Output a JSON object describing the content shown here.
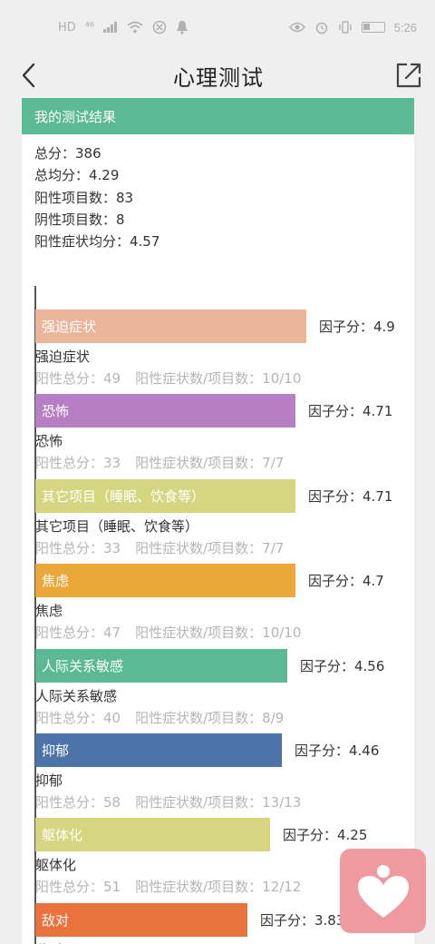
{
  "status": {
    "time": "5:26",
    "carrier": "HD",
    "net": "⁴⁶"
  },
  "nav": {
    "title": "心理测试"
  },
  "result": {
    "header": "我的测试结果",
    "lines": [
      "总分：386",
      "总均分：4.29",
      "阳性项目数：83",
      "阴性项目数：8",
      "阳性症状均分：4.57"
    ]
  },
  "chart_data": {
    "type": "bar",
    "orientation": "horizontal",
    "categories": [
      "强迫症状",
      "恐怖",
      "其它项目（睡眠、饮食等）",
      "焦虑",
      "人际关系敏感",
      "抑郁",
      "躯体化",
      "敌对"
    ],
    "values": [
      4.9,
      4.71,
      4.71,
      4.7,
      4.56,
      4.46,
      4.25,
      3.83
    ],
    "xlim": [
      0,
      5.5
    ],
    "colors": [
      "#ebb59c",
      "#b67fc4",
      "#d6d681",
      "#eca73a",
      "#5bb995",
      "#4c73aa",
      "#d6d681",
      "#e9723d"
    ]
  },
  "factors": [
    {
      "bar_label": "强迫症状",
      "score": "因子分：4.9",
      "name": "强迫症状",
      "total": "阳性总分：49",
      "ratio": "阳性症状数/项目数：10/10"
    },
    {
      "bar_label": "恐怖",
      "score": "因子分：4.71",
      "name": "恐怖",
      "total": "阳性总分：33",
      "ratio": "阳性症状数/项目数：7/7"
    },
    {
      "bar_label": "其它项目（睡眠、饮食等）",
      "score": "因子分：4.71",
      "name": "其它项目（睡眠、饮食等）",
      "total": "阳性总分：33",
      "ratio": "阳性症状数/项目数：7/7"
    },
    {
      "bar_label": "焦虑",
      "score": "因子分：4.7",
      "name": "焦虑",
      "total": "阳性总分：47",
      "ratio": "阳性症状数/项目数：10/10"
    },
    {
      "bar_label": "人际关系敏感",
      "score": "因子分：4.56",
      "name": "人际关系敏感",
      "total": "阳性总分：40",
      "ratio": "阳性症状数/项目数：8/9"
    },
    {
      "bar_label": "抑郁",
      "score": "因子分：4.46",
      "name": "抑郁",
      "total": "阳性总分：58",
      "ratio": "阳性症状数/项目数：13/13"
    },
    {
      "bar_label": "躯体化",
      "score": "因子分：4.25",
      "name": "躯体化",
      "total": "阳性总分：51",
      "ratio": "阳性症状数/项目数：12/12"
    },
    {
      "bar_label": "敌对",
      "score": "因子分：3.83",
      "name": "敌对",
      "total": "",
      "ratio": ""
    }
  ],
  "icons": {
    "back": "back-arrow-icon",
    "share": "share-icon",
    "fab": "heart-person-icon"
  }
}
